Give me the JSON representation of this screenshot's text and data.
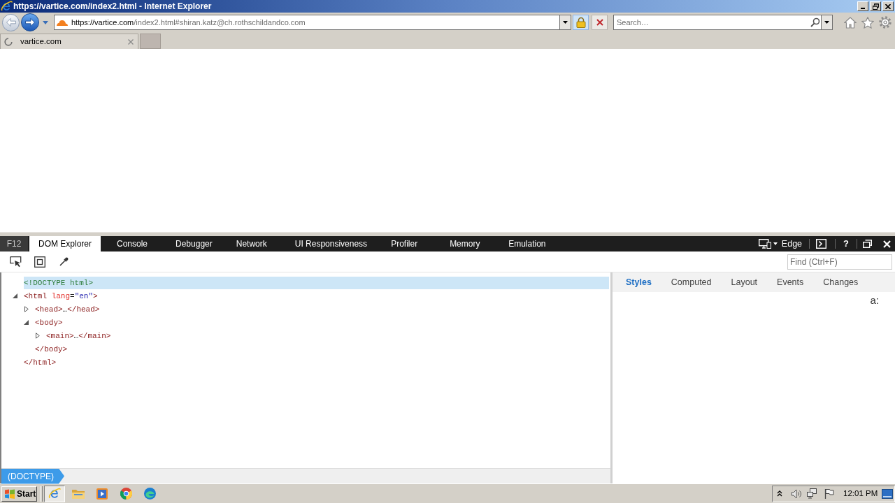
{
  "window": {
    "title": "https://vartice.com/index2.html - Internet Explorer"
  },
  "address_bar": {
    "url_domain": "https://vartice.com",
    "url_path": "/index2.html#shiran.katz@ch.rothschildandco.com"
  },
  "search_box": {
    "placeholder": "Search…"
  },
  "browser_tabs": [
    {
      "label": "vartice.com",
      "selected": true,
      "loading": true
    }
  ],
  "devtools": {
    "f12_label": "F12",
    "tabs": [
      {
        "label": "DOM Explorer",
        "selected": true
      },
      {
        "label": "Console",
        "selected": false
      },
      {
        "label": "Debugger",
        "selected": false
      },
      {
        "label": "Network",
        "selected": false
      },
      {
        "label": "UI Responsiveness",
        "selected": false
      },
      {
        "label": "Profiler",
        "selected": false
      },
      {
        "label": "Memory",
        "selected": false
      },
      {
        "label": "Emulation",
        "selected": false
      }
    ],
    "browser_mode": "Edge",
    "help_label": "?",
    "find_field": {
      "placeholder": "Find (Ctrl+F)"
    },
    "dom_tree": [
      {
        "kind": "doctype",
        "text": "<!DOCTYPE html>",
        "selected": true
      },
      {
        "kind": "element",
        "selected": false,
        "expanded": true,
        "tokens": [
          {
            "kind": "tag",
            "text": "<html"
          },
          {
            "kind": "attribute",
            "text": "lang"
          },
          {
            "kind": "punctuation",
            "text": "="
          },
          {
            "kind": "value",
            "text": "\"en\""
          },
          {
            "kind": "tag",
            "text": ">"
          }
        ],
        "children": [
          {
            "kind": "element",
            "selected": false,
            "expanded": false,
            "tokens": [
              {
                "kind": "tag",
                "text": "<head>"
              },
              {
                "kind": "ellipsis",
                "text": "…"
              },
              {
                "kind": "tag",
                "text": "</head>"
              }
            ]
          },
          {
            "kind": "element",
            "selected": false,
            "expanded": true,
            "tokens": [
              {
                "kind": "tag",
                "text": "<body>"
              }
            ],
            "children": [
              {
                "kind": "element",
                "selected": false,
                "expanded": false,
                "tokens": [
                  {
                    "kind": "tag",
                    "text": "<main>"
                  },
                  {
                    "kind": "ellipsis",
                    "text": "…"
                  },
                  {
                    "kind": "tag",
                    "text": "</main>"
                  }
                ]
              }
            ],
            "closing": "</body>"
          }
        ],
        "closing": "</html>"
      }
    ],
    "side_tabs": [
      {
        "label": "Styles",
        "selected": true
      },
      {
        "label": "Computed",
        "selected": false
      },
      {
        "label": "Layout",
        "selected": false
      },
      {
        "label": "Events",
        "selected": false
      },
      {
        "label": "Changes",
        "selected": false
      }
    ],
    "pseudo_toggle": "a:",
    "breadcrumbs": [
      {
        "label": "(DOCTYPE)",
        "selected": true
      }
    ]
  },
  "taskbar": {
    "start_label": "Start",
    "buttons": [
      {
        "selected": true
      },
      {
        "selected": false
      },
      {
        "selected": false
      },
      {
        "selected": false
      },
      {
        "selected": false
      }
    ],
    "clock": "12:01 PM"
  }
}
